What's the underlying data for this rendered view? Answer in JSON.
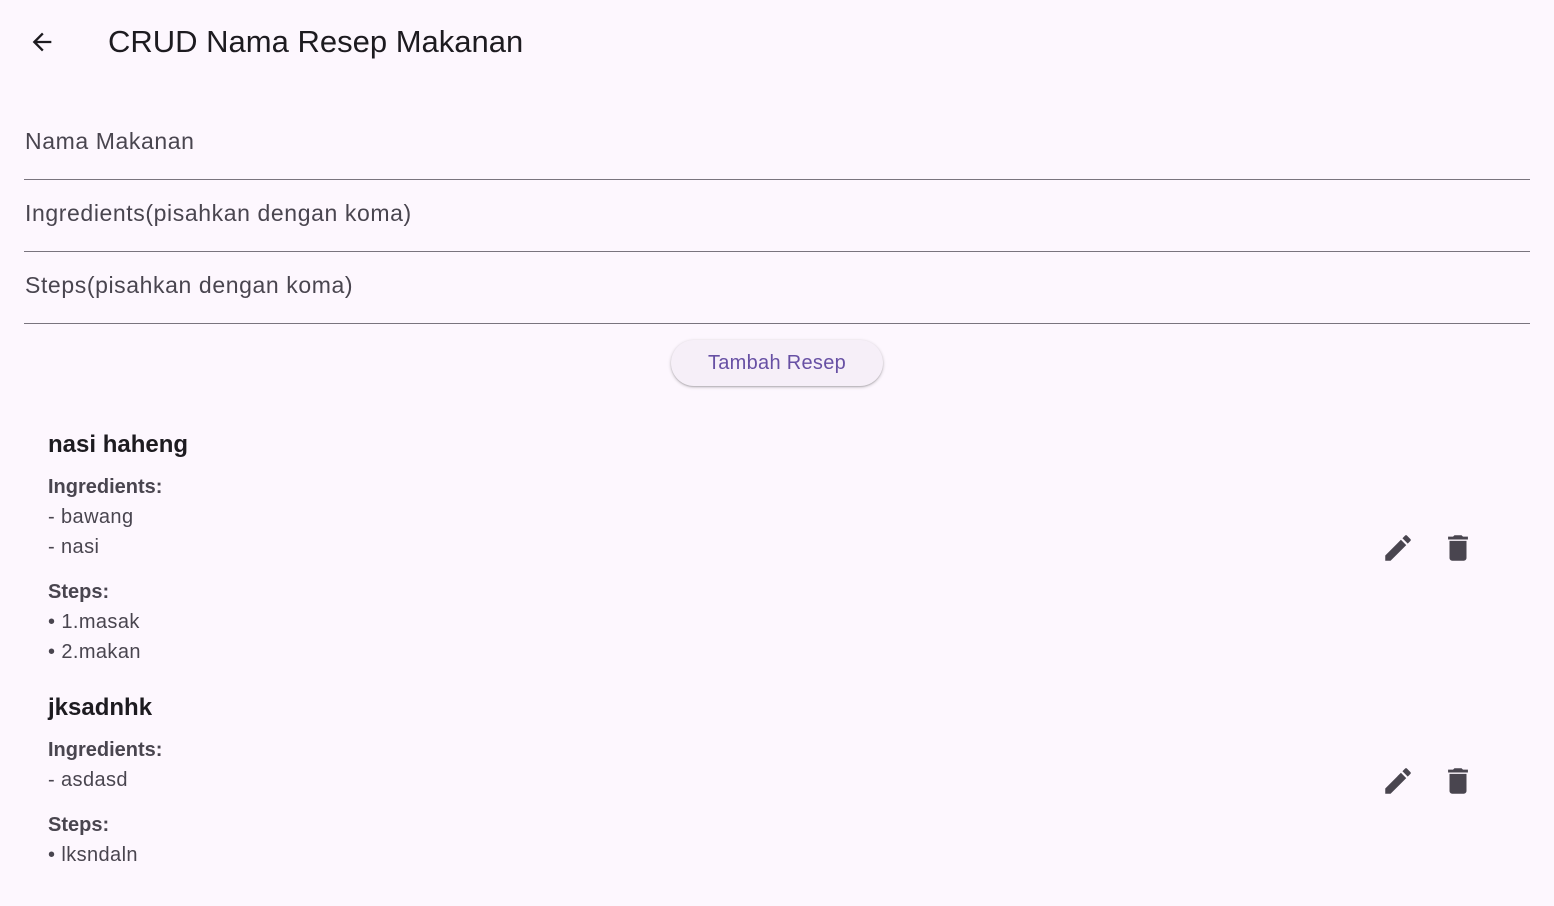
{
  "appbar": {
    "back_icon": "arrow-back-icon",
    "title": "CRUD Nama Resep Makanan"
  },
  "form": {
    "name_placeholder": "Nama Makanan",
    "name_value": "",
    "ingredients_placeholder": "Ingredients(pisahkan dengan koma)",
    "ingredients_value": "",
    "steps_placeholder": "Steps(pisahkan dengan koma)",
    "steps_value": "",
    "submit_label": "Tambah Resep"
  },
  "recipes": [
    {
      "name": "nasi haheng",
      "ingredients_label": "Ingredients:",
      "ingredients": [
        "- bawang",
        "- nasi"
      ],
      "steps_label": "Steps:",
      "steps": [
        "• 1.masak",
        "• 2.makan"
      ],
      "edit_icon": "edit-icon",
      "delete_icon": "delete-icon"
    },
    {
      "name": "jksadnhk",
      "ingredients_label": "Ingredients:",
      "ingredients": [
        "- asdasd"
      ],
      "steps_label": "Steps:",
      "steps": [
        "• lksndaln"
      ],
      "edit_icon": "edit-icon",
      "delete_icon": "delete-icon"
    }
  ],
  "colors": {
    "background": "#fdf7fe",
    "accent": "#6750a4",
    "icon": "#49454f",
    "divider": "#79747e"
  }
}
